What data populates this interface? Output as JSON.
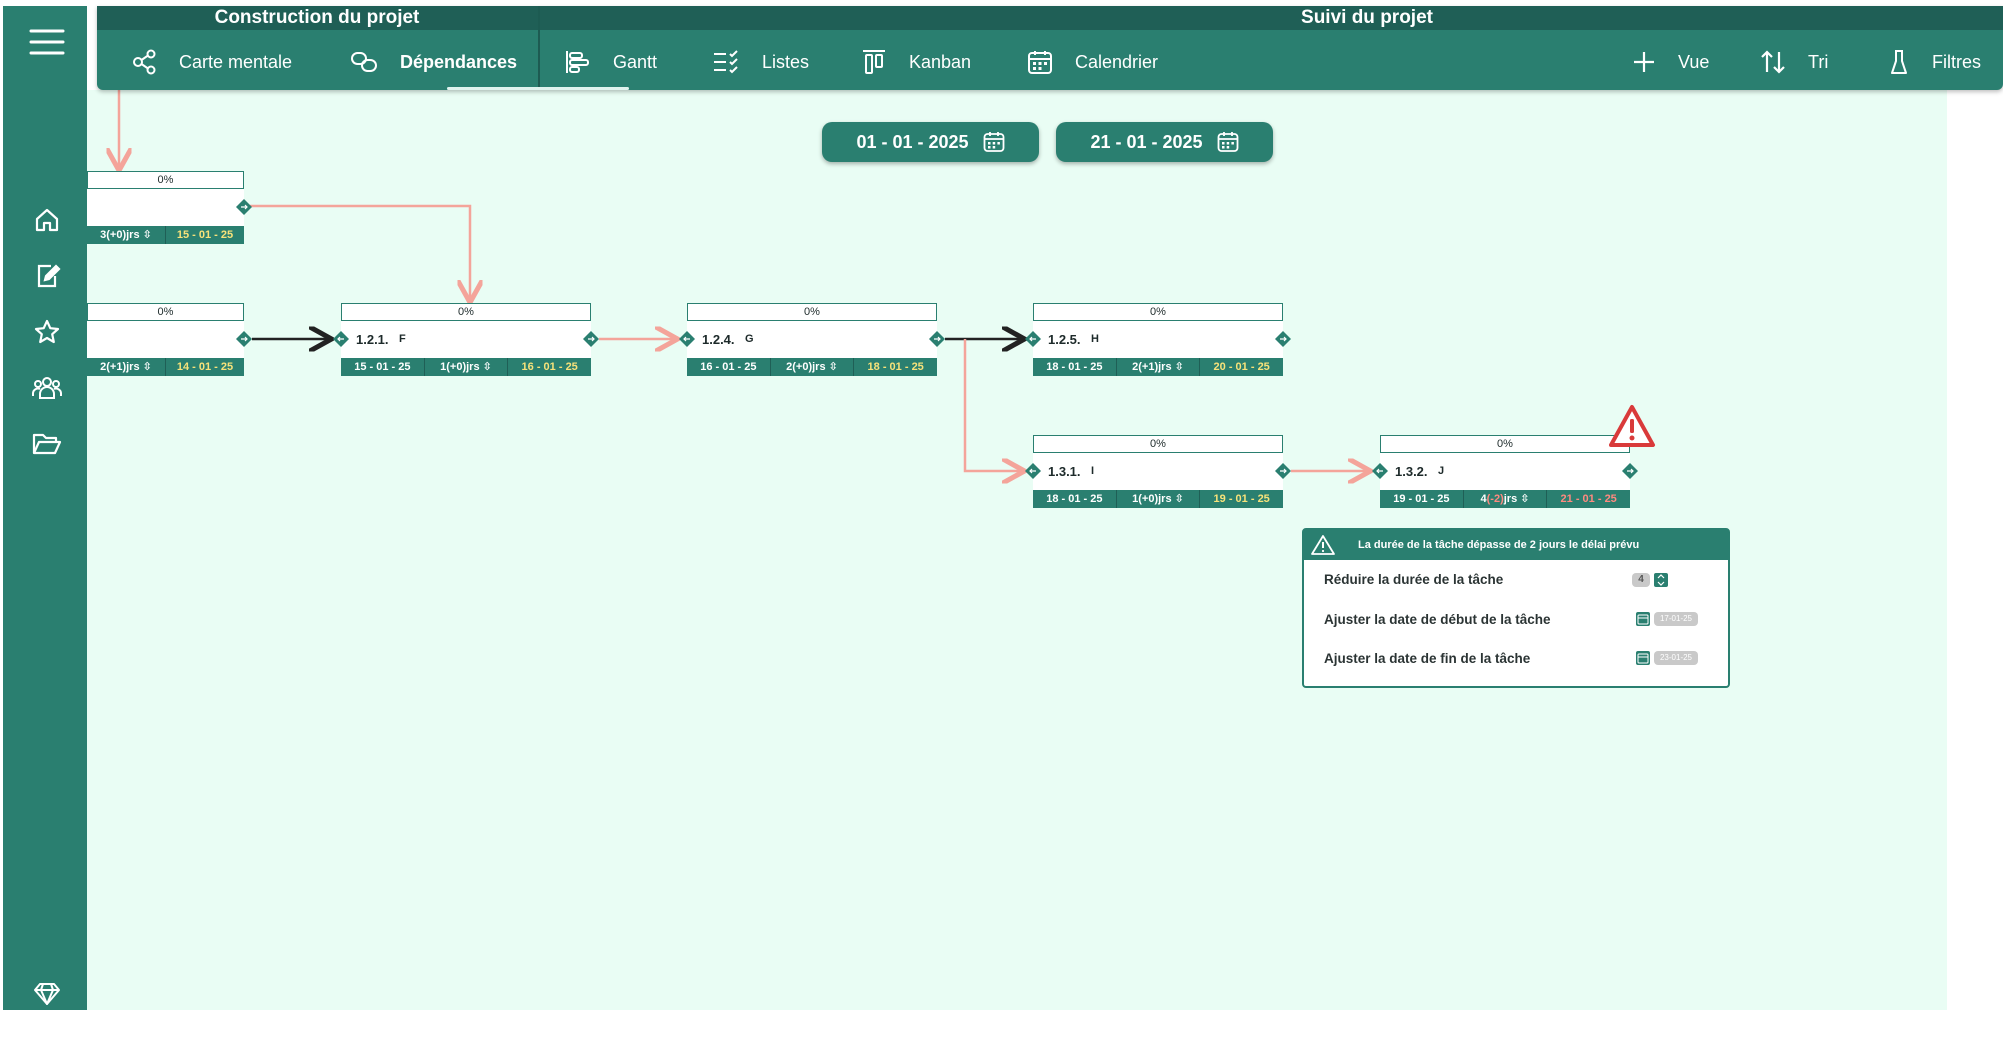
{
  "topbar": {
    "section_construction": "Construction du projet",
    "section_suivi": "Suivi du projet",
    "nav": {
      "carte_mentale": "Carte mentale",
      "dependances": "Dépendances",
      "gantt": "Gantt",
      "listes": "Listes",
      "kanban": "Kanban",
      "calendrier": "Calendrier",
      "vue": "Vue",
      "tri": "Tri",
      "filtres": "Filtres"
    },
    "active_tab": "Dépendances"
  },
  "date_range": {
    "start": "01 - 01 - 2025",
    "end": "21 - 01 - 2025"
  },
  "tasks": {
    "partial_top": {
      "progress": "0%",
      "duration": "3(+0)jrs",
      "end": "15 - 01 - 25"
    },
    "partial_mid": {
      "progress": "0%",
      "duration": "2(+1)jrs",
      "end": "14 - 01 - 25"
    },
    "f": {
      "progress": "0%",
      "code": "1.2.1.",
      "name": "F",
      "start": "15 - 01 - 25",
      "duration": "1(+0)jrs",
      "end": "16 - 01 - 25"
    },
    "g": {
      "progress": "0%",
      "code": "1.2.4.",
      "name": "G",
      "start": "16 - 01 - 25",
      "duration": "2(+0)jrs",
      "end": "18 - 01 - 25"
    },
    "h": {
      "progress": "0%",
      "code": "1.2.5.",
      "name": "H",
      "start": "18 - 01 - 25",
      "duration": "2(+1)jrs",
      "end": "20 - 01 - 25"
    },
    "i": {
      "progress": "0%",
      "code": "1.3.1.",
      "name": "I",
      "start": "18 - 01 - 25",
      "duration": "1(+0)jrs",
      "end": "19 - 01 - 25"
    },
    "j": {
      "progress": "0%",
      "code": "1.3.2.",
      "name": "J",
      "start": "19 - 01 - 25",
      "duration_base": "4",
      "duration_delta": "(-2)",
      "duration_unit": "jrs",
      "end": "21 - 01 - 25"
    }
  },
  "alert": {
    "title": "La durée de la tâche dépasse de 2 jours le délai prévu",
    "reduce_label": "Réduire la durée de la tâche",
    "reduce_value": "4",
    "start_label": "Ajuster la date de début de la tâche",
    "start_value": "17-01-25",
    "end_label": "Ajuster la date de fin de la tâche",
    "end_value": "23-01-25"
  },
  "colors": {
    "primary": "#2a7f70",
    "primary_dark": "#1f5f56",
    "canvas": "#e9fdf4",
    "link_red": "#f4a49a",
    "link_black": "#222222",
    "highlight_yellow": "#f7e27a",
    "warning_red": "#d93a3a"
  }
}
